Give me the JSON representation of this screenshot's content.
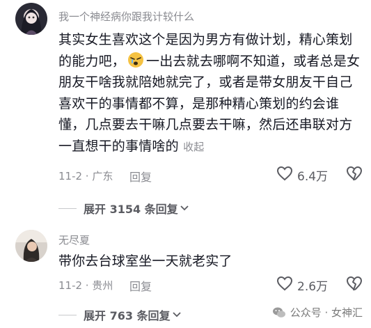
{
  "comments": [
    {
      "username": "我一个神经病你跟我计较什么",
      "content_before_emoji": "其实女生喜欢这个是因为男方有做计划，精心策划的能力吧，",
      "emoji": "crying-face-emoji",
      "content_after_emoji": "一出去就去哪啊不知道，或者总是女朋友干啥我就陪她就完了，或者是带女朋友干自己喜欢干的事情都不算，是那种精心策划的约会谁懂，几点要去干嘛几点要去干嘛，然后还串联对方一直想干的事情啥的",
      "collapse_label": "收起",
      "date_location": "11-2 · 广东",
      "reply_label": "回复",
      "likes": "6.4万",
      "expand_label": "展开 3154 条回复"
    },
    {
      "username": "无尽夏",
      "content": "带你去台球室坐一天就老实了",
      "date_location": "11-2 · 贵州",
      "reply_label": "回复",
      "likes": "2.6万",
      "expand_label": "展开 763 条回复"
    }
  ],
  "watermark": {
    "text": "公众号 · 女神汇"
  },
  "colors": {
    "primary_text": "#161823",
    "secondary_text": "#8a8b91"
  }
}
